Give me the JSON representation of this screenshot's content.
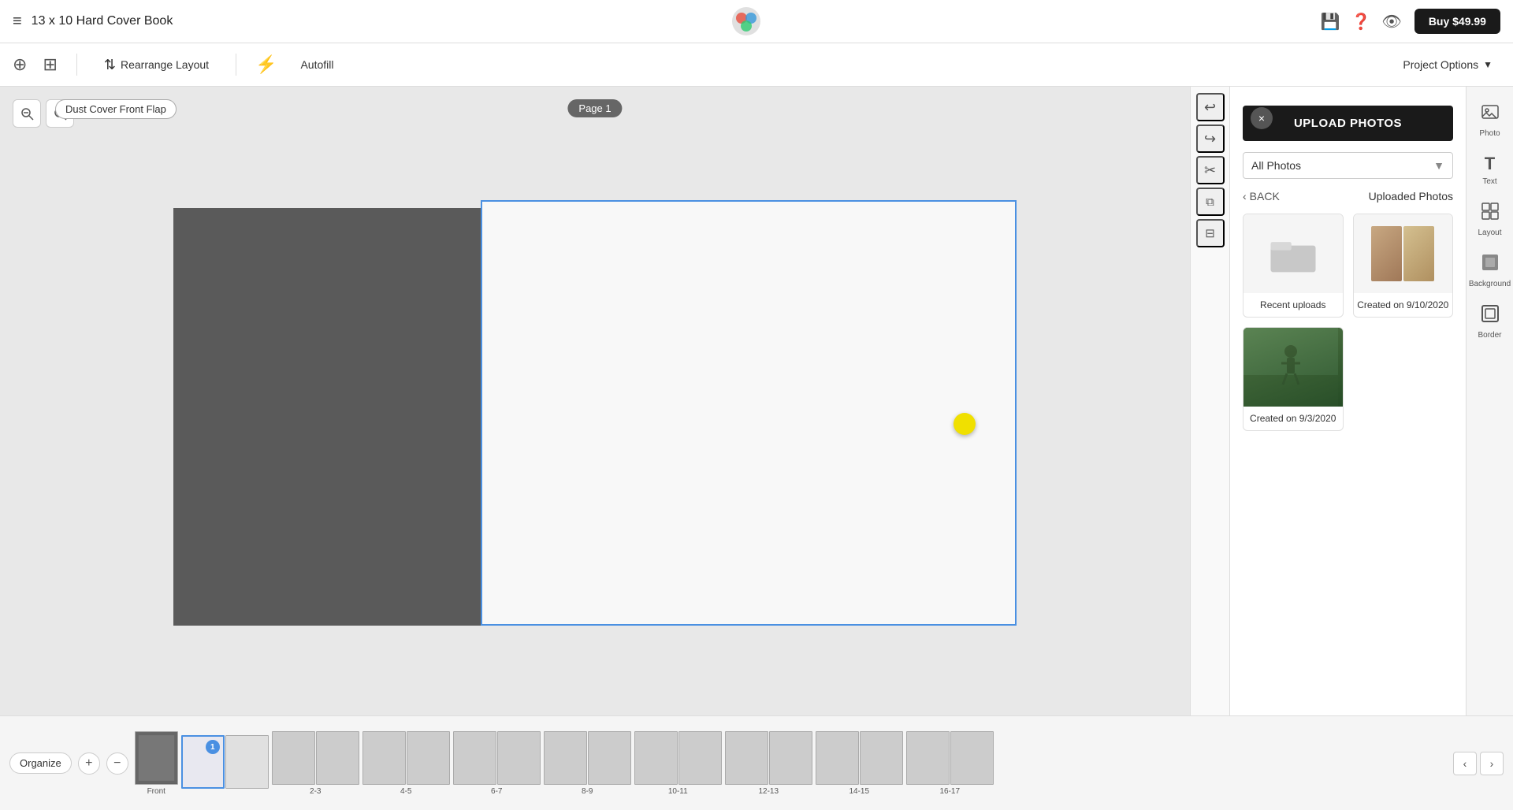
{
  "app": {
    "logo_unicode": "🎨",
    "buy_button": "Buy $49.99",
    "project_title": "13 x 10 Hard Cover Book"
  },
  "toolbar": {
    "rearrange_layout": "Rearrange Layout",
    "autofill": "Autofill",
    "project_options": "Project Options",
    "project_options_arrow": "▼"
  },
  "canvas": {
    "page_label": "Page 1",
    "dust_cover_label": "Dust Cover Front Flap"
  },
  "photos_panel": {
    "upload_button": "UPLOAD PHOTOS",
    "filter_label": "All Photos",
    "back_label": "BACK",
    "uploaded_label": "Uploaded Photos",
    "close_icon": "×",
    "albums": [
      {
        "id": "recent",
        "label": "Recent uploads",
        "type": "folder"
      },
      {
        "id": "sept10",
        "label": "Created on 9/10/2020",
        "type": "multi-photo"
      },
      {
        "id": "sept3",
        "label": "Created on 9/3/2020",
        "type": "single-photo"
      }
    ]
  },
  "far_right": {
    "items": [
      {
        "id": "photo",
        "icon": "🖼",
        "label": "Photo"
      },
      {
        "id": "text",
        "icon": "T",
        "label": "Text"
      },
      {
        "id": "layout",
        "icon": "⊞",
        "label": "Layout"
      },
      {
        "id": "background",
        "icon": "⬛",
        "label": "Background"
      },
      {
        "id": "border",
        "icon": "▣",
        "label": "Border"
      }
    ]
  },
  "vertical_tools": [
    {
      "id": "undo",
      "icon": "↩"
    },
    {
      "id": "redo",
      "icon": "↪"
    },
    {
      "id": "scissors",
      "icon": "✂"
    },
    {
      "id": "copy",
      "icon": "⧉"
    },
    {
      "id": "paste",
      "icon": "📋"
    }
  ],
  "zoom": {
    "zoom_out": "🔍-",
    "zoom_in": "🔍+"
  },
  "bottom": {
    "organize": "Organize",
    "add_page": "+",
    "remove_page": "−",
    "nav_prev": "‹",
    "nav_next": "›",
    "front_label": "Front",
    "pages": [
      {
        "num": "",
        "label": "Front",
        "type": "front"
      },
      {
        "num": "1",
        "label": "",
        "type": "active"
      },
      {
        "num": "2",
        "label": "",
        "type": "normal"
      },
      {
        "num": "3",
        "label": "",
        "type": "normal"
      },
      {
        "num": "4",
        "label": "",
        "type": "normal"
      },
      {
        "num": "5",
        "label": "",
        "type": "normal"
      },
      {
        "num": "6",
        "label": "",
        "type": "normal"
      },
      {
        "num": "7",
        "label": "",
        "type": "normal"
      },
      {
        "num": "8",
        "label": "",
        "type": "normal"
      },
      {
        "num": "9",
        "label": "",
        "type": "normal"
      },
      {
        "num": "10",
        "label": "",
        "type": "normal"
      },
      {
        "num": "11",
        "label": "",
        "type": "normal"
      },
      {
        "num": "12",
        "label": "",
        "type": "normal"
      },
      {
        "num": "13",
        "label": "",
        "type": "normal"
      },
      {
        "num": "14",
        "label": "",
        "type": "normal"
      },
      {
        "num": "15",
        "label": "",
        "type": "normal"
      },
      {
        "num": "16",
        "label": "",
        "type": "normal"
      },
      {
        "num": "17",
        "label": "",
        "type": "normal"
      }
    ]
  }
}
